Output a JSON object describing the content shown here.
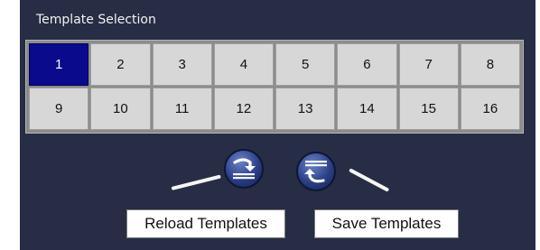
{
  "panel": {
    "title": "Template Selection"
  },
  "templates": {
    "selected": "1",
    "cells": [
      "1",
      "2",
      "3",
      "4",
      "5",
      "6",
      "7",
      "8",
      "9",
      "10",
      "11",
      "12",
      "13",
      "14",
      "15",
      "16"
    ]
  },
  "actions": {
    "reload_label": "Reload Templates",
    "save_label": "Save Templates",
    "reload_icon": "reload-templates-icon",
    "save_icon": "save-templates-icon"
  },
  "colors": {
    "panel_bg": "#262d44",
    "selected_cell": "#0a0a8c",
    "cell_bg": "#d7d7d7"
  }
}
